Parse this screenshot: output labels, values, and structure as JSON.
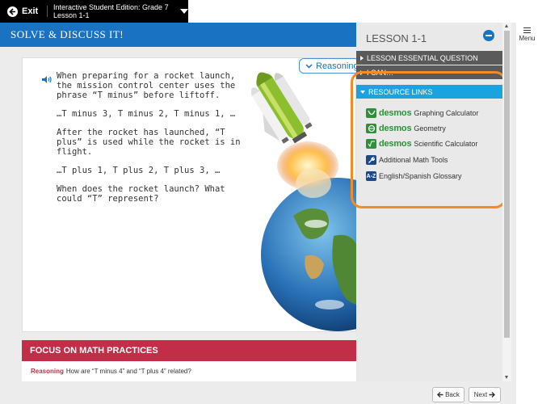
{
  "topbar": {
    "exit_label": "Exit",
    "edition": "Interactive Student Edition: Grade 7 Lesson 1-1"
  },
  "menu": {
    "label": "Menu"
  },
  "header": {
    "title": "SOLVE & DISCUSS IT!"
  },
  "prompt": {
    "p1": "When preparing for a rocket launch, the mission control center uses the phrase “T minus” before liftoff.",
    "p2": "…T minus 3, T minus 2, T minus 1, …",
    "p3": "After the rocket has launched, “T plus” is used while the rocket is in flight.",
    "p4": "…T plus 1, T plus 2, T plus 3, …",
    "p5": "When does the rocket launch? What could “T” represent?"
  },
  "reasoning_tab": {
    "label": "Reasoning"
  },
  "focus": {
    "title": "FOCUS ON MATH PRACTICES",
    "keyword": "Reasoning",
    "question": "How are “T minus 4” and “T plus 4” related?"
  },
  "panel": {
    "title": "LESSON 1-1",
    "sections": [
      "LESSON ESSENTIAL QUESTION",
      "I CAN…",
      "RESOURCE LINKS"
    ],
    "links": [
      {
        "brand": "desmos",
        "label": "Graphing Calculator",
        "icon": "desmos-graphing-icon"
      },
      {
        "brand": "desmos",
        "label": "Geometry",
        "icon": "desmos-geometry-icon"
      },
      {
        "brand": "desmos",
        "label": "Scientific Calculator",
        "icon": "desmos-scientific-icon"
      },
      {
        "brand": "",
        "label": "Additional Math Tools",
        "icon": "wrench-icon"
      },
      {
        "brand": "",
        "label": "English/Spanish Glossary",
        "icon": "glossary-icon",
        "icon_text": "A-Z"
      }
    ]
  },
  "nav": {
    "back_label": "Back",
    "next_label": "Next"
  },
  "colors": {
    "header_blue": "#1a73c2",
    "focus_red": "#c22e48",
    "resource_blue": "#1aa3de",
    "desmos_green": "#2f8f3a",
    "highlight_orange": "#f28c28"
  }
}
